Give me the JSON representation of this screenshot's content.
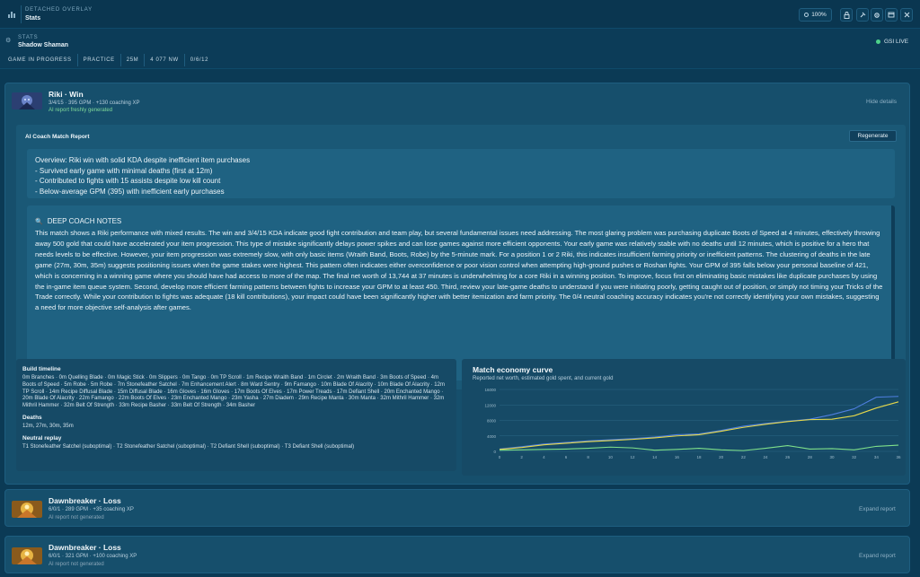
{
  "window": {
    "overlay_label": "DETACHED OVERLAY",
    "title": "Stats",
    "zoom": "100%"
  },
  "header": {
    "section_label": "STATS",
    "hero": "Shadow Shaman",
    "live_label": "GSI LIVE",
    "chips": [
      "GAME IN PROGRESS",
      "PRACTICE",
      "25M",
      "4 077 NW",
      "0/6/12"
    ]
  },
  "match1": {
    "title": "Riki · Win",
    "subtitle": "3/4/15 · 395 GPM · +130 coaching XP",
    "status": "AI report freshly generated",
    "action": "Hide details",
    "report_title": "AI Coach Match Report",
    "regenerate": "Regenerate",
    "overview": [
      "Overview: Riki win with solid KDA despite inefficient item purchases",
      "- Survived early game with minimal deaths (first at 12m)",
      "- Contributed to fights with 15 assists despite low kill count",
      "- Below-average GPM (395) with inefficient early purchases"
    ],
    "deep_title": "DEEP COACH NOTES",
    "deep_body": "This match shows a Riki performance with mixed results. The win and 3/4/15 KDA indicate good fight contribution and team play, but several fundamental issues need addressing. The most glaring problem was purchasing duplicate Boots of Speed at 4 minutes, effectively throwing away 500 gold that could have accelerated your item progression. This type of mistake significantly delays power spikes and can lose games against more efficient opponents. Your early game was relatively stable with no deaths until 12 minutes, which is positive for a hero that needs levels to be effective. However, your item progression was extremely slow, with only basic items (Wraith Band, Boots, Robe) by the 5-minute mark. For a position 1 or 2 Riki, this indicates insufficient farming priority or inefficient patterns. The clustering of deaths in the late game (27m, 30m, 35m) suggests positioning issues when the game stakes were highest. This pattern often indicates either overconfidence or poor vision control when attempting high-ground pushes or Roshan fights. Your GPM of 395 falls below your personal baseline of 421, which is concerning in a winning game where you should have had access to more of the map. The final net worth of 13,744 at 37 minutes is underwhelming for a core Riki in a winning position. To improve, focus first on eliminating basic mistakes like duplicate purchases by using the in-game item queue system. Second, develop more efficient farming patterns between fights to increase your GPM to at least 450. Third, review your late-game deaths to understand if you were initiating poorly, getting caught out of position, or simply not timing your Tricks of the Trade correctly. While your contribution to fights was adequate (18 kill contributions), your impact could have been significantly higher with better itemization and farm priority. The 0/4 neutral coaching accuracy indicates you're not correctly identifying your own mistakes, suggesting a need for more objective self-analysis after games.",
    "build_label": "Build timeline",
    "build_text": "0m Branches · 0m Quelling Blade · 0m Magic Stick · 0m Slippers · 0m Tango · 0m TP Scroll · 1m Recipe Wraith Band · 1m Circlet · 2m Wraith Band · 3m Boots of Speed · 4m Boots of Speed · 5m Robe · 5m Robe · 7m Stonefeather Satchel · 7m Enhancement Alert · 8m Ward Sentry · 9m Famango · 10m Blade Of Alacrity · 10m Blade Of Alacrity · 12m TP Scroll · 14m Recipe Diffusal Blade · 15m Diffusal Blade · 16m Gloves · 16m Gloves · 17m Boots Of Elves · 17m Power Treads · 17m Defiant Shell · 20m Enchanted Mango · 20m Blade Of Alacrity · 22m Famango · 22m Boots Of Elves · 23m Enchanted Mango · 23m Yasha · 27m Diadem · 29m Recipe Manta · 30m Manta · 32m Mithril Hammer · 32m Mithril Hammer · 32m Belt Of Strength · 33m Recipe Basher · 33m Belt Of Strength · 34m Basher",
    "deaths_label": "Deaths",
    "deaths_text": "12m, 27m, 30m, 35m",
    "neutral_label": "Neutral replay",
    "neutral_text": "T1 Stonefeather Satchel (suboptimal) · T2 Stonefeather Satchel (suboptimal) · T2 Defiant Shell (suboptimal) · T3 Defiant Shell (suboptimal)",
    "economy_title": "Match economy curve",
    "economy_sub": "Reported net worth, estimated gold spent, and current gold"
  },
  "match2": {
    "title": "Dawnbreaker · Loss",
    "subtitle": "6/0/1 · 289 GPM · +35 coaching XP",
    "status": "AI report not generated",
    "action": "Expand report"
  },
  "match3": {
    "title": "Dawnbreaker · Loss",
    "subtitle": "6/0/1 · 321 GPM · +100 coaching XP",
    "status": "AI report not generated",
    "action": "Expand report"
  },
  "chart_data": {
    "type": "line",
    "title": "Match economy curve",
    "subtitle": "Reported net worth, estimated gold spent, and current gold",
    "x": [
      0,
      2,
      4,
      6,
      8,
      10,
      12,
      14,
      16,
      18,
      20,
      22,
      24,
      26,
      28,
      30,
      32,
      34,
      36
    ],
    "xlim": [
      0,
      36
    ],
    "ylim": [
      0,
      16000
    ],
    "yticks": [
      0,
      4000,
      8000,
      12000,
      16000
    ],
    "xticks": [
      0,
      2,
      4,
      6,
      8,
      10,
      12,
      14,
      16,
      18,
      20,
      22,
      24,
      26,
      28,
      30,
      32,
      34,
      36
    ],
    "grid": true,
    "series": [
      {
        "color": "#4f7fe0",
        "values": [
          600,
          1200,
          1900,
          2300,
          2700,
          3000,
          3300,
          3700,
          4300,
          4500,
          5400,
          6500,
          7200,
          7800,
          8300,
          9500,
          11000,
          14000,
          14200
        ]
      },
      {
        "color": "#e6d84a",
        "values": [
          500,
          1000,
          1700,
          2100,
          2500,
          2800,
          3100,
          3500,
          4000,
          4300,
          5200,
          6200,
          7000,
          7700,
          8200,
          8300,
          9200,
          11200,
          12800
        ]
      },
      {
        "color": "#7fe08a",
        "values": [
          300,
          400,
          500,
          600,
          800,
          1100,
          900,
          300,
          500,
          800,
          400,
          200,
          800,
          1500,
          600,
          700,
          400,
          1300,
          1600
        ]
      }
    ]
  }
}
